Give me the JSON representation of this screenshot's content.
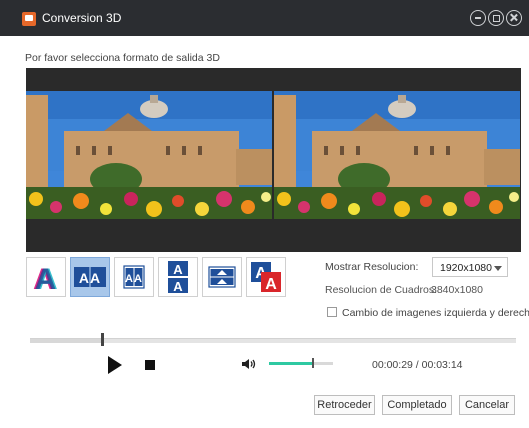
{
  "window": {
    "title": "Conversion 3D",
    "accent_color": "#e6682a",
    "titlebar_color": "#2b2d31"
  },
  "prompt": "Por favor selecciona formato de salida 3D",
  "formats": [
    {
      "glyph": "A",
      "icon": "anaglyph-3d-icon",
      "selected": false
    },
    {
      "glyph": "AA",
      "icon": "side-by-side-full-icon",
      "selected": true
    },
    {
      "glyph": "AA",
      "icon": "side-by-side-half-icon",
      "selected": false
    },
    {
      "glyph": "A",
      "icon": "top-bottom-full-icon",
      "selected": false
    },
    {
      "glyph": "A",
      "icon": "top-bottom-half-icon",
      "selected": false
    },
    {
      "glyph": "A",
      "icon": "red-blue-icon",
      "selected": false
    }
  ],
  "resolution": {
    "label": "Mostrar Resolucion:",
    "value": "1920x1080",
    "frame_label": "Resolucion de Cuadros:",
    "frame_value": "3840x1080",
    "swap_label": "Cambio de imagenes izquierda y derecha",
    "swap_checked": false
  },
  "playback": {
    "seek_progress": 0.15,
    "volume_level": 0.68,
    "volume_color": "#2ec9a2",
    "time": "00:00:29 / 00:03:14"
  },
  "buttons": {
    "back": "Retroceder",
    "done": "Completado",
    "cancel": "Cancelar"
  }
}
